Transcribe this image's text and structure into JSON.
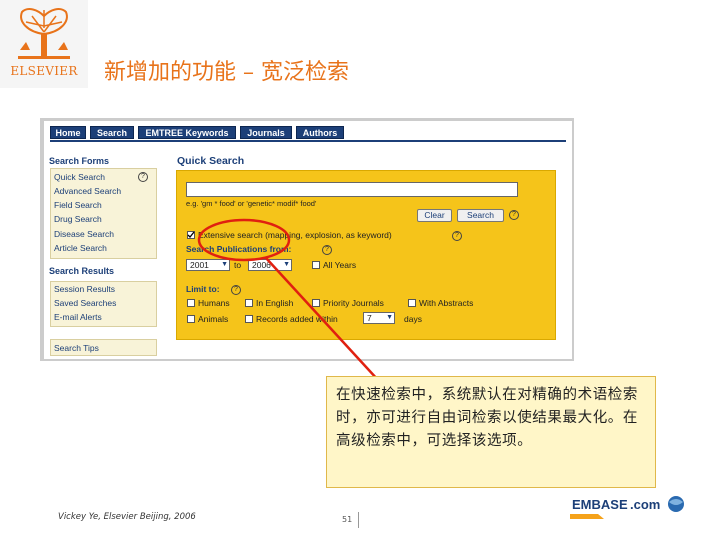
{
  "header": {
    "logo_text": "ELSEVIER",
    "title": "新增加的功能 – 宽泛检索"
  },
  "nav": {
    "tabs": [
      "Home",
      "Search",
      "EMTREE Keywords",
      "Journals",
      "Authors"
    ]
  },
  "sidebar": {
    "search_forms_heading": "Search Forms",
    "search_forms": [
      "Quick Search",
      "Advanced Search",
      "Field Search",
      "Drug Search",
      "Disease Search",
      "Article Search"
    ],
    "search_results_heading": "Search Results",
    "search_results": [
      "Session Results",
      "Saved Searches",
      "E-mail Alerts"
    ],
    "search_tips": "Search Tips"
  },
  "quick_search": {
    "title": "Quick Search",
    "input_value": "",
    "example_text": "e.g. 'gm * food' or 'genetic* modif* food'",
    "clear_label": "Clear",
    "search_label": "Search",
    "extensive_search_label": "Extensive search (mapping, explosion, as keyword)",
    "extensive_search_checked": true,
    "publications_label": "Search Publications from:",
    "year_from": "2001",
    "to_label": "to",
    "year_to": "2006",
    "all_years_label": "All Years",
    "limit_to_label": "Limit to:",
    "limits": [
      "Humans",
      "In English",
      "Priority Journals",
      "With Abstracts"
    ],
    "animals_label": "Animals",
    "records_added_label": "Records added within",
    "days_value": "7",
    "days_label": "days"
  },
  "callout": {
    "text": "在快速检索中，系统默认在对精确的术语检索时，亦可进行自由词检索以使结果最大化。在高级检索中，可选择该选项。"
  },
  "footer": {
    "credit": "Vickey Ye, Elsevier Beijing, 2006",
    "page_number": "51",
    "brand_logo_text": "EMBASE.com"
  },
  "colors": {
    "title_orange": "#e8731a",
    "nav_blue": "#1c3f78",
    "panel_yellow": "#f5c41a",
    "annotation_red": "#e02010"
  }
}
